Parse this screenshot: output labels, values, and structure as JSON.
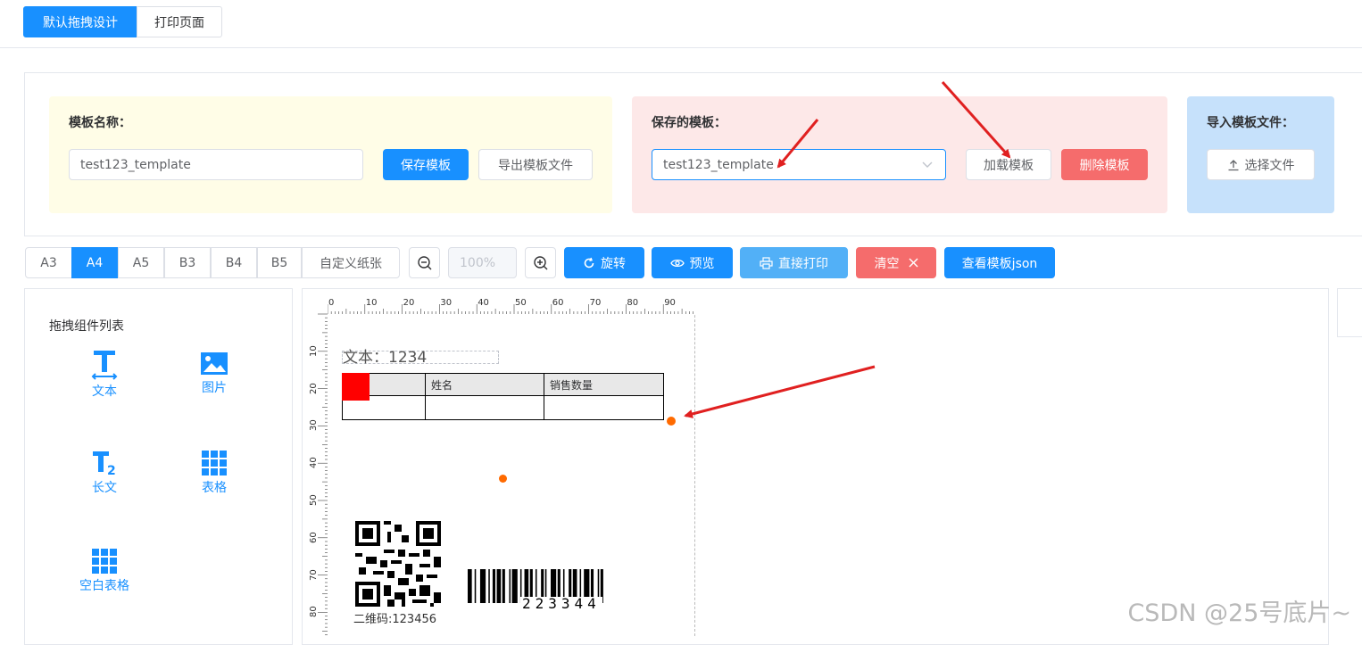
{
  "tabs": [
    {
      "label": "默认拖拽设计",
      "active": true
    },
    {
      "label": "打印页面",
      "active": false
    }
  ],
  "template_name_card": {
    "title": "模板名称：",
    "input_value": "test123_template",
    "save_label": "保存模板",
    "export_label": "导出模板文件",
    "bg": "#fffde7"
  },
  "saved_card": {
    "title": "保存的模板：",
    "select_value": "test123_template",
    "load_label": "加载模板",
    "delete_label": "删除模板",
    "bg": "#fde8e8"
  },
  "import_card": {
    "title": "导入模板文件：",
    "choose_label": "选择文件",
    "bg": "#c6e1fb"
  },
  "paper_sizes": [
    "A3",
    "A4",
    "A5",
    "B3",
    "B4",
    "B5",
    "自定义纸张"
  ],
  "active_paper": "A4",
  "zoom": "100%",
  "toolbar": {
    "rotate_label": "旋转",
    "preview_label": "预览",
    "print_label": "直接打印",
    "clear_label": "清空",
    "json_label": "查看模板json"
  },
  "component_list": {
    "title": "拖拽组件列表",
    "items": [
      {
        "label": "文本",
        "icon": "text-icon"
      },
      {
        "label": "图片",
        "icon": "image-icon"
      },
      {
        "label": "长文",
        "icon": "long-text-icon"
      },
      {
        "label": "表格",
        "icon": "table-icon"
      },
      {
        "label": "空白表格",
        "icon": "blank-table-icon"
      }
    ]
  },
  "design": {
    "ruler_top": [
      "0",
      "10",
      "20",
      "30",
      "40",
      "50",
      "60",
      "70",
      "80",
      "90"
    ],
    "ruler_left": [
      "10",
      "20",
      "30",
      "40",
      "50",
      "60",
      "70",
      "80"
    ],
    "text_element": "文本：1234",
    "table_headers": [
      "",
      "姓名",
      "销售数量"
    ],
    "qr_caption": "二维码:123456",
    "barcode_text": "223344"
  },
  "watermark": "CSDN @25号底片~",
  "colors": {
    "primary": "#1890ff",
    "danger": "#f56c6c",
    "light_primary": "#52b0f7",
    "annotation_arrow": "#e02020",
    "handle": "#ff6a00"
  }
}
